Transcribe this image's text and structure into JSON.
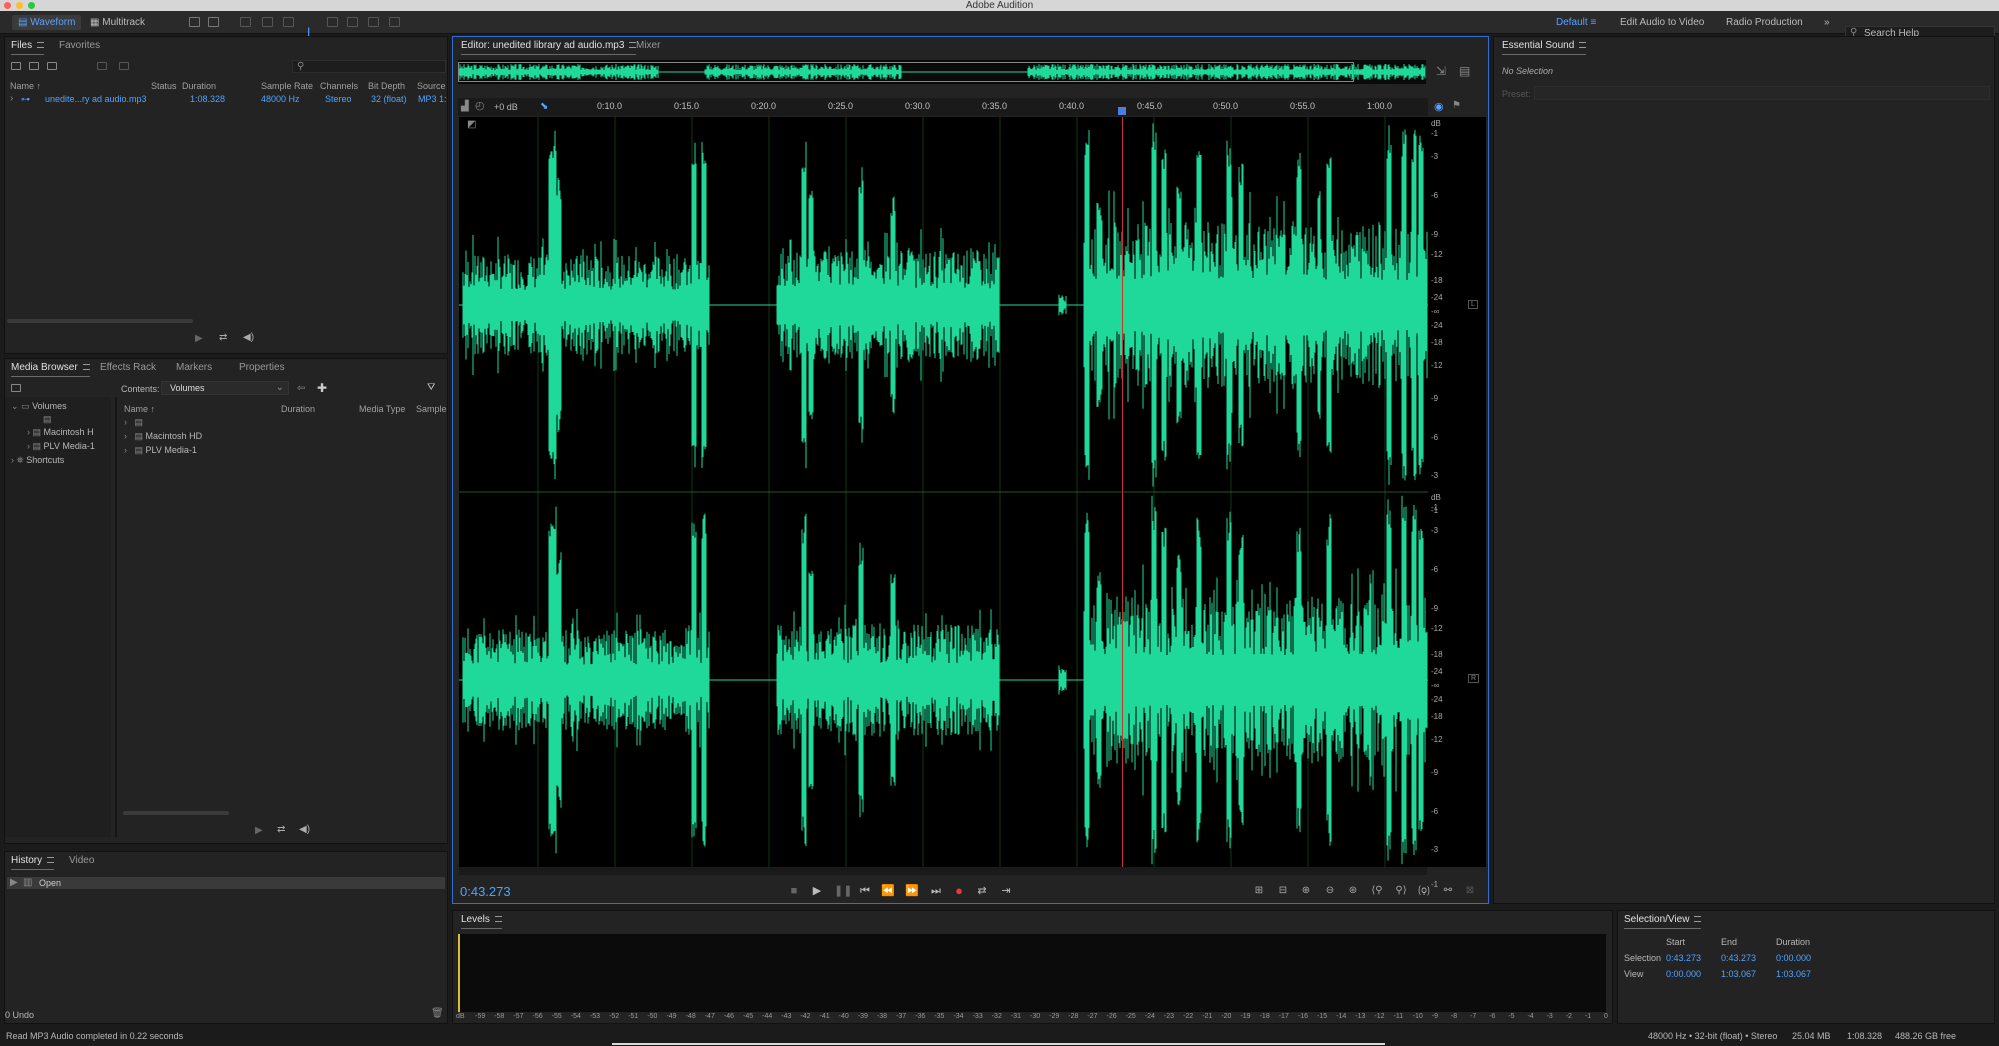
{
  "app": {
    "title": "Adobe Audition"
  },
  "toolbar": {
    "waveform": "Waveform",
    "multitrack": "Multitrack",
    "workspace_default": "Default",
    "edit_audio_to_video": "Edit Audio to Video",
    "radio_production": "Radio Production",
    "more": "»",
    "search_help": "Search Help"
  },
  "files_panel": {
    "tabs": [
      "Files",
      "Favorites"
    ],
    "columns": [
      "Name ↑",
      "Status",
      "Duration",
      "Sample Rate",
      "Channels",
      "Bit Depth",
      "Source"
    ],
    "row": {
      "name": "unedite...ry ad audio.mp3",
      "status": "",
      "duration": "1:08.328",
      "sample_rate": "48000 Hz",
      "channels": "Stereo",
      "bit_depth": "32 (float)",
      "source": "MP3 1:"
    }
  },
  "media_panel": {
    "tabs": [
      "Media Browser",
      "Effects Rack",
      "Markers",
      "Properties"
    ],
    "contents_label": "Contents:",
    "contents_value": "Volumes",
    "tree": [
      "Volumes",
      "",
      "Macintosh H",
      "PLV Media-1",
      "Shortcuts"
    ],
    "columns": [
      "Name ↑",
      "Duration",
      "Media Type",
      "Sample"
    ],
    "items": [
      "",
      "Macintosh HD",
      "PLV Media-1"
    ]
  },
  "history_panel": {
    "tabs": [
      "History",
      "Video"
    ],
    "items": [
      "Open"
    ],
    "undo": "0 Undo"
  },
  "editor": {
    "tabs": [
      "Editor: unedited library ad audio.mp3",
      "Mixer"
    ],
    "gain": "+0 dB",
    "time": "0:43.273",
    "ruler": [
      "0:10.0",
      "0:15.0",
      "0:20.0",
      "0:25.0",
      "0:30.0",
      "0:35.0",
      "0:40.0",
      "0:45.0",
      "0:50.0",
      "0:55.0",
      "1:00.0"
    ],
    "db_top": [
      "dB",
      "-1",
      "-3",
      "-6",
      "-9",
      "-12",
      "-18",
      "-24",
      "-∞",
      "-24",
      "-18",
      "-12",
      "-9",
      "-6",
      "-3",
      "-1"
    ],
    "db_bottom": [
      "dB",
      "-1",
      "-3",
      "-6",
      "-9",
      "-12",
      "-18",
      "-24",
      "-∞",
      "-24",
      "-18",
      "-12",
      "-9",
      "-6",
      "-3",
      "-1"
    ],
    "channel_left": "L",
    "channel_right": "R",
    "wave_color": "#1ed99a"
  },
  "essential_sound": {
    "title": "Essential Sound",
    "no_selection": "No Selection",
    "preset_label": "Preset:"
  },
  "levels": {
    "title": "Levels",
    "scale": [
      "dB",
      "-59",
      "-58",
      "-57",
      "-56",
      "-55",
      "-54",
      "-53",
      "-52",
      "-51",
      "-50",
      "-49",
      "-48",
      "-47",
      "-46",
      "-45",
      "-44",
      "-43",
      "-42",
      "-41",
      "-40",
      "-39",
      "-38",
      "-37",
      "-36",
      "-35",
      "-34",
      "-33",
      "-32",
      "-31",
      "-30",
      "-29",
      "-28",
      "-27",
      "-26",
      "-25",
      "-24",
      "-23",
      "-22",
      "-21",
      "-20",
      "-19",
      "-18",
      "-17",
      "-16",
      "-15",
      "-14",
      "-13",
      "-12",
      "-11",
      "-10",
      "-9",
      "-8",
      "-7",
      "-6",
      "-5",
      "-4",
      "-3",
      "-2",
      "-1",
      "0"
    ]
  },
  "selection_view": {
    "title": "Selection/View",
    "headers": [
      "Start",
      "End",
      "Duration"
    ],
    "selection": {
      "label": "Selection",
      "start": "0:43.273",
      "end": "0:43.273",
      "duration": "0:00.000"
    },
    "view": {
      "label": "View",
      "start": "0:00.000",
      "end": "1:03.067",
      "duration": "1:03.067"
    }
  },
  "status": {
    "message": "Read MP3 Audio completed in 0.22 seconds",
    "format": "48000 Hz • 32-bit (float) • Stereo",
    "size": "25.04 MB",
    "duration": "1:08.328",
    "free": "488.26 GB free"
  }
}
